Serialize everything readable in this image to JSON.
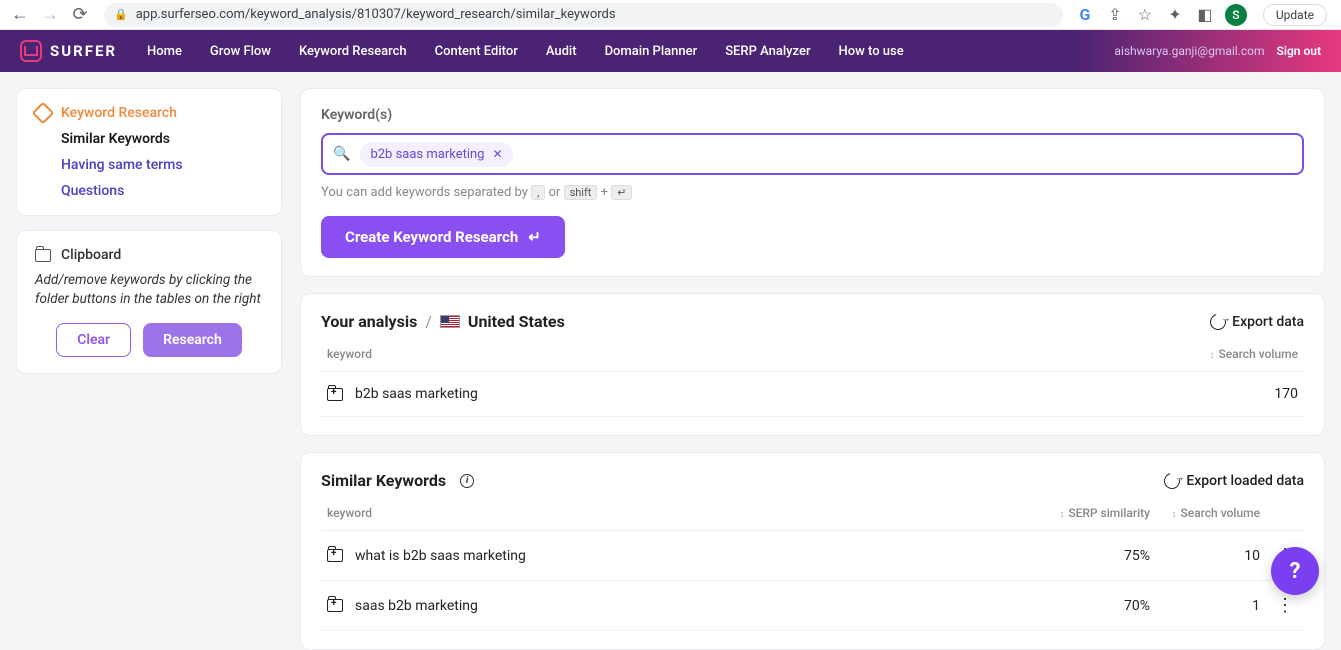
{
  "browser": {
    "url": "app.surferseo.com/keyword_analysis/810307/keyword_research/similar_keywords",
    "avatar_initial": "S",
    "update_label": "Update"
  },
  "header": {
    "brand": "SURFER",
    "nav": [
      "Home",
      "Grow Flow",
      "Keyword Research",
      "Content Editor",
      "Audit",
      "Domain Planner",
      "SERP Analyzer",
      "How to use"
    ],
    "email": "aishwarya.ganji@gmail.com",
    "signout": "Sign out"
  },
  "sidebar": {
    "section_title": "Keyword Research",
    "items": [
      {
        "label": "Similar Keywords",
        "active": true
      },
      {
        "label": "Having same terms",
        "active": false
      },
      {
        "label": "Questions",
        "active": false
      }
    ],
    "clipboard": {
      "title": "Clipboard",
      "desc": "Add/remove keywords by clicking the folder buttons in the tables on the right",
      "clear": "Clear",
      "research": "Research"
    }
  },
  "keywords_panel": {
    "label": "Keyword(s)",
    "chip": "b2b saas marketing",
    "hint_prefix": "You can add keywords separated by ",
    "hint_comma": ",",
    "hint_or": " or ",
    "hint_shift": "shift",
    "hint_plus": " + ",
    "hint_enter": "↵",
    "create_btn": "Create Keyword Research"
  },
  "analysis": {
    "title": "Your analysis",
    "country": "United States",
    "export": "Export data",
    "col_keyword": "keyword",
    "col_volume": "Search volume",
    "rows": [
      {
        "keyword": "b2b saas marketing",
        "volume": "170"
      }
    ]
  },
  "similar": {
    "title": "Similar Keywords",
    "export": "Export loaded data",
    "col_keyword": "keyword",
    "col_serp": "SERP similarity",
    "col_volume": "Search volume",
    "rows": [
      {
        "keyword": "what is b2b saas marketing",
        "serp": "75%",
        "volume": "10"
      },
      {
        "keyword": "saas b2b marketing",
        "serp": "70%",
        "volume": "1"
      }
    ]
  }
}
